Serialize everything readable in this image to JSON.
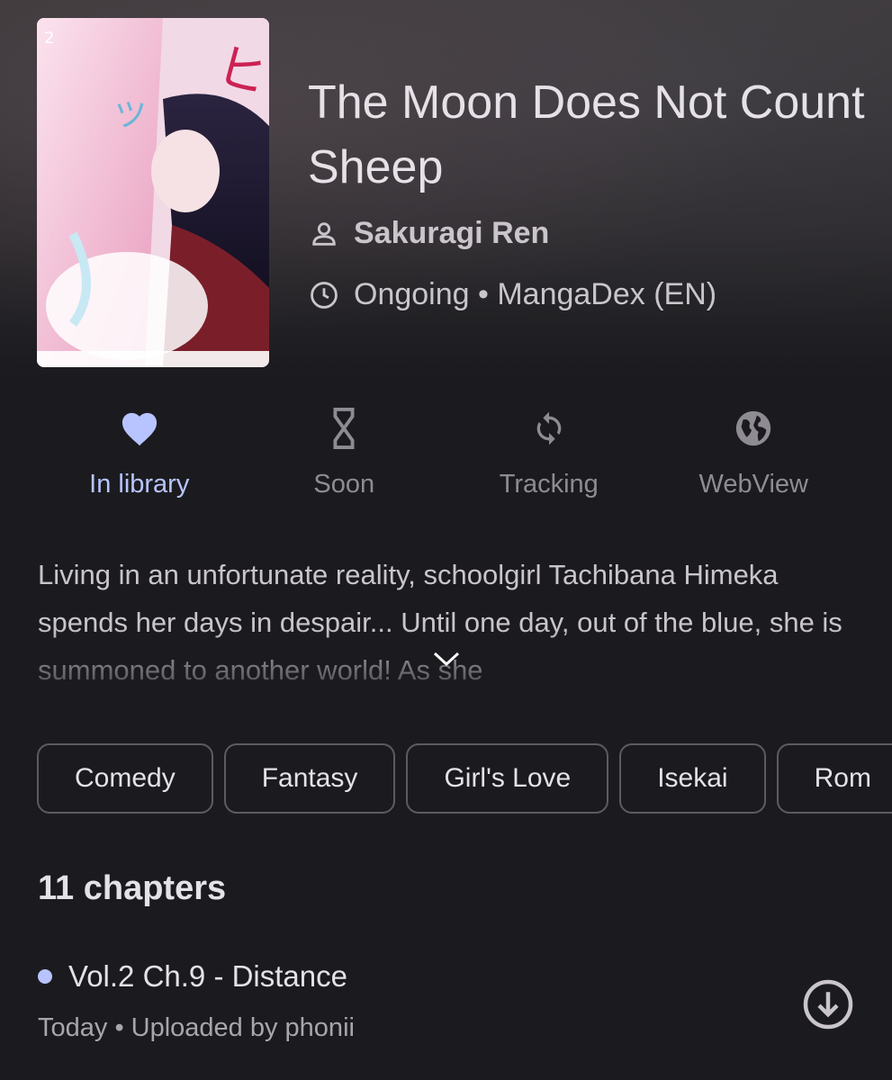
{
  "manga": {
    "title": "The Moon Does Not Count Sheep",
    "author": "Sakuragi Ren",
    "status_line": "Ongoing • MangaDex (EN)"
  },
  "actions": [
    {
      "label": "In library",
      "icon": "heart-icon",
      "active": true
    },
    {
      "label": "Soon",
      "icon": "hourglass-icon",
      "active": false
    },
    {
      "label": "Tracking",
      "icon": "sync-icon",
      "active": false
    },
    {
      "label": "WebView",
      "icon": "globe-icon",
      "active": false
    }
  ],
  "description": "Living in an unfortunate reality, schoolgirl Tachibana Himeka spends her days in despair... Until one day, out of the blue, she is summoned to another world! As she",
  "genres": [
    "Comedy",
    "Fantasy",
    "Girl's Love",
    "Isekai",
    "Rom"
  ],
  "chapters": {
    "count_label": "11 chapters",
    "items": [
      {
        "title": "Vol.2 Ch.9 - Distance",
        "subtitle": "Today • Uploaded by phonii"
      }
    ]
  },
  "colors": {
    "accent": "#b8c4ff",
    "background": "#1b1b1f",
    "muted": "#8e8c92"
  }
}
